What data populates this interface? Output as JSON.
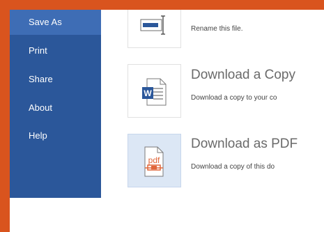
{
  "sidebar": {
    "items": [
      {
        "label": "Save As",
        "selected": true
      },
      {
        "label": "Print"
      },
      {
        "label": "Share"
      },
      {
        "label": "About"
      },
      {
        "label": "Help"
      }
    ]
  },
  "main": {
    "rename": {
      "description": "Rename this file.",
      "icon": "rename-icon"
    },
    "download_copy": {
      "title": "Download a Copy",
      "description": "Download a copy to your co",
      "icon": "word-document-icon"
    },
    "download_pdf": {
      "title": "Download as PDF",
      "description": "Download a copy of this do",
      "icon": "pdf-document-icon",
      "icon_text": "pdf"
    }
  },
  "colors": {
    "frame": "#d9541e",
    "sidebar": "#2b579a",
    "sidebar_selected": "#3e6db5",
    "highlight_tile": "#dce7f5",
    "word_blue": "#2b579a",
    "pdf_orange": "#e0663a"
  }
}
